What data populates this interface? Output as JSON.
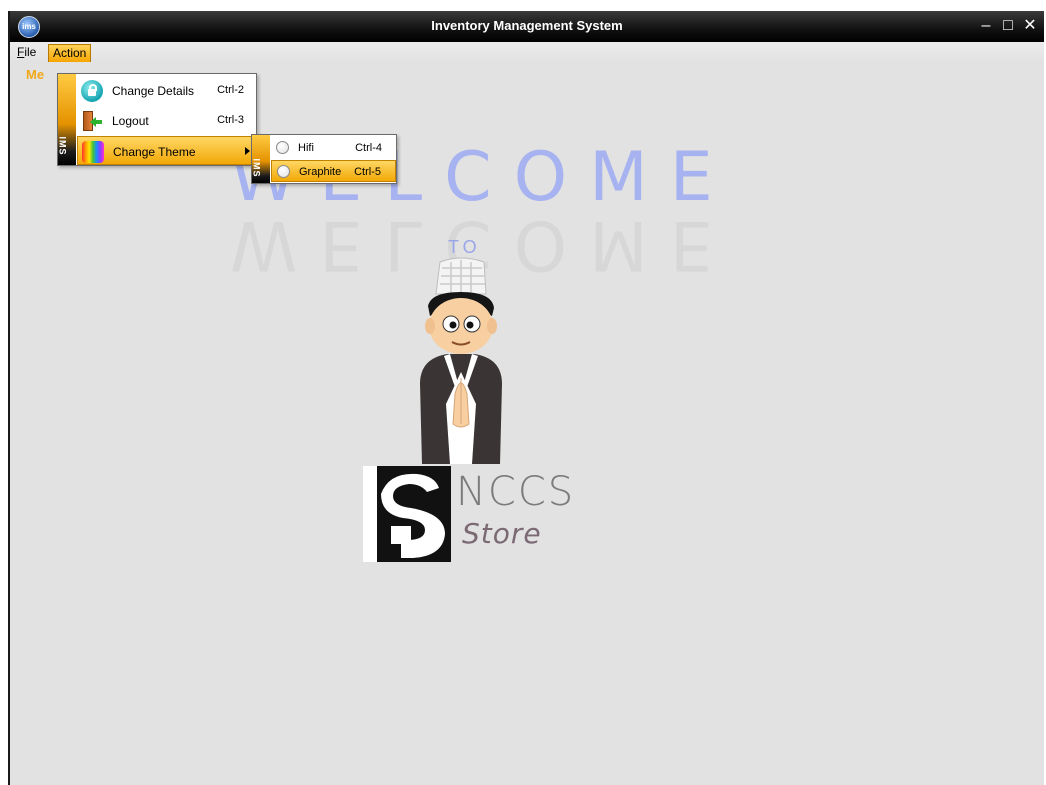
{
  "window": {
    "title": "Inventory Management System",
    "app_icon_text": "ims"
  },
  "menubar": {
    "file_label_mnemonic": "F",
    "file_label_rest": "ile",
    "action_label": "Action"
  },
  "under_label": "Me",
  "action_menu": {
    "side_label": "IMS",
    "items": [
      {
        "label": "Change Details",
        "accel": "Ctrl-2",
        "icon": "lock-icon"
      },
      {
        "label": "Logout",
        "accel": "Ctrl-3",
        "icon": "logout-door-icon"
      },
      {
        "label": "Change Theme",
        "accel": "",
        "icon": "color-palette-icon",
        "selected": true
      }
    ]
  },
  "theme_submenu": {
    "side_label": "IMS",
    "items": [
      {
        "label": "Hifi",
        "accel": "Ctrl-4"
      },
      {
        "label": "Graphite",
        "accel": "Ctrl-5",
        "selected": true
      }
    ]
  },
  "splash": {
    "welcome": "WELCOME",
    "to": "TO",
    "brand": "NCCS",
    "sub": "Store"
  },
  "colors": {
    "accent": "#f5a500",
    "welcome": "#a7b3f0",
    "titlebar": "#111111"
  }
}
